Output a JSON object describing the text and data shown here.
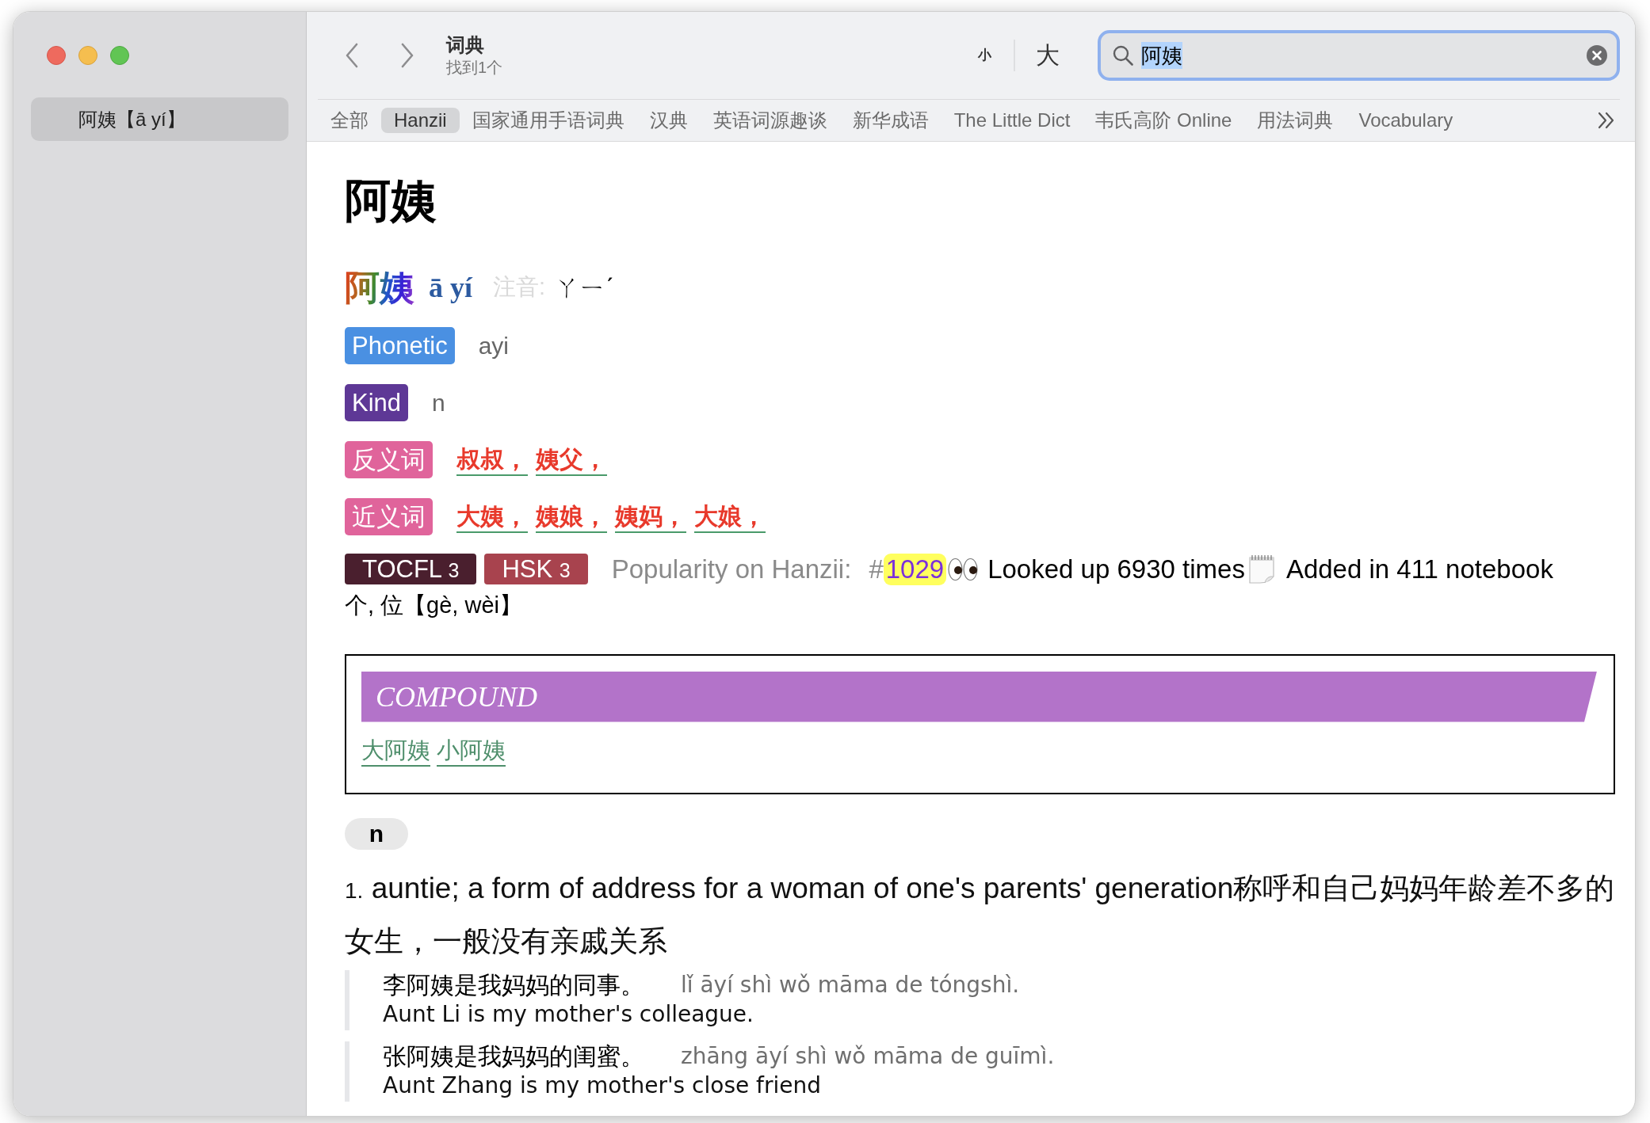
{
  "sidebar": {
    "items": [
      {
        "label": "阿姨【ā yí】",
        "selected": true
      }
    ]
  },
  "toolbar": {
    "title": "词典",
    "subtitle": "找到1个",
    "font_smaller": "小",
    "font_larger": "大",
    "search": {
      "value": "阿姨",
      "value_selected": true
    }
  },
  "tabs": [
    {
      "label": "全部",
      "selected": false
    },
    {
      "label": "Hanzii",
      "selected": true
    },
    {
      "label": "国家通用手语词典",
      "selected": false
    },
    {
      "label": "汉典",
      "selected": false
    },
    {
      "label": "英语词源趣谈",
      "selected": false
    },
    {
      "label": "新华成语",
      "selected": false
    },
    {
      "label": "The Little Dict",
      "selected": false
    },
    {
      "label": "韦氏高阶 Online",
      "selected": false
    },
    {
      "label": "用法词典",
      "selected": false
    },
    {
      "label": "Vocabulary",
      "selected": false
    }
  ],
  "entry": {
    "headword": "阿姨",
    "pronunciation": {
      "characters": "阿姨",
      "pinyin": "ā yí",
      "zhuyin_label": "注音:",
      "zhuyin": "ㄚㄧˊ"
    },
    "fields": [
      {
        "kind": "text",
        "label": "Phonetic",
        "color": "#4a90e2",
        "value": "ayi"
      },
      {
        "kind": "text",
        "label": "Kind",
        "color": "#5e3896",
        "value": "n"
      },
      {
        "kind": "links",
        "label": "反义词",
        "color": "#e0649b",
        "links": [
          "叔叔，",
          "姨父，"
        ]
      },
      {
        "kind": "links",
        "label": "近义词",
        "color": "#e0649b",
        "links": [
          "大姨，",
          "姨娘，",
          "姨妈，",
          "大娘，"
        ]
      }
    ],
    "levels": [
      {
        "name": "TOCFL",
        "grade": "3",
        "color": "#4a1f2e"
      },
      {
        "name": "HSK",
        "grade": "3",
        "color": "#a8434e"
      }
    ],
    "popularity": {
      "label": "Popularity on Hanzii:",
      "rank_prefix": "#",
      "rank": "1029",
      "lookups": "Looked up 6930 times",
      "notebooks": "Added in 411 notebook"
    },
    "measure_words": "个, 位【gè, wèi】",
    "compound": {
      "title": "COMPOUND",
      "words": [
        "大阿姨",
        "小阿姨"
      ]
    },
    "senses": [
      {
        "pos": "n",
        "definitions": [
          {
            "number": "1.",
            "text": "auntie; a form of address for a woman of one's parents' generation称呼和自己妈妈年龄差不多的女生，一般没有亲戚关系",
            "examples": [
              {
                "chinese": "李阿姨是我妈妈的同事。",
                "pinyin": "lǐ āyí shì wǒ māma de tóngshì.",
                "english": "Aunt Li is my mother's colleague."
              },
              {
                "chinese": "张阿姨是我妈妈的闺蜜。",
                "pinyin": "zhāng āyí shì wǒ māma de guīmì.",
                "english": "Aunt Zhang is my mother's close friend"
              }
            ]
          }
        ]
      }
    ]
  }
}
